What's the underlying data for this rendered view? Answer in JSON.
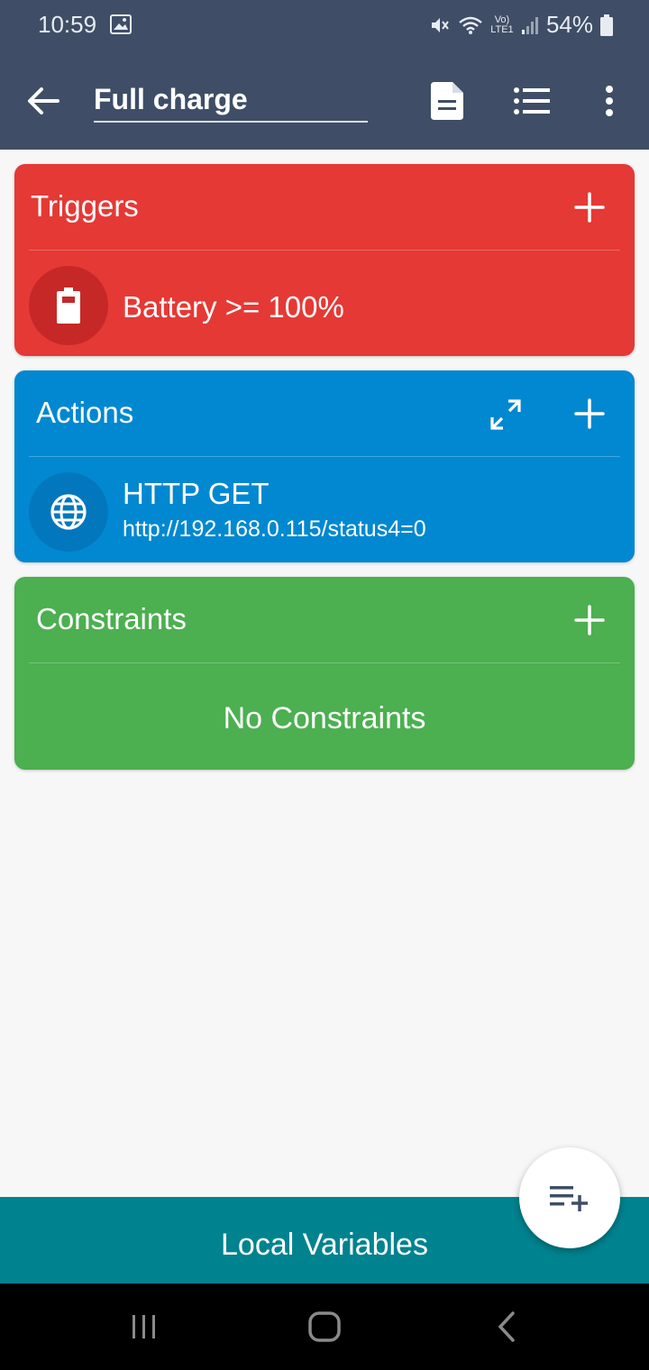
{
  "status": {
    "time": "10:59",
    "battery_pct": "54%",
    "network_label": "Vo) LTE1"
  },
  "toolbar": {
    "title": "Full charge"
  },
  "triggers": {
    "title": "Triggers",
    "items": [
      {
        "label": "Battery >= 100%",
        "icon": "battery-icon"
      }
    ]
  },
  "actions": {
    "title": "Actions",
    "items": [
      {
        "label": "HTTP GET",
        "detail": "http://192.168.0.115/status4=0",
        "icon": "globe-icon"
      }
    ]
  },
  "constraints": {
    "title": "Constraints",
    "empty": "No Constraints"
  },
  "bottom": {
    "label": "Local Variables"
  },
  "colors": {
    "toolbar": "#3f4e66",
    "triggers": "#e53935",
    "actions": "#0288d1",
    "constraints": "#4caf50",
    "bottom": "#00838f"
  }
}
